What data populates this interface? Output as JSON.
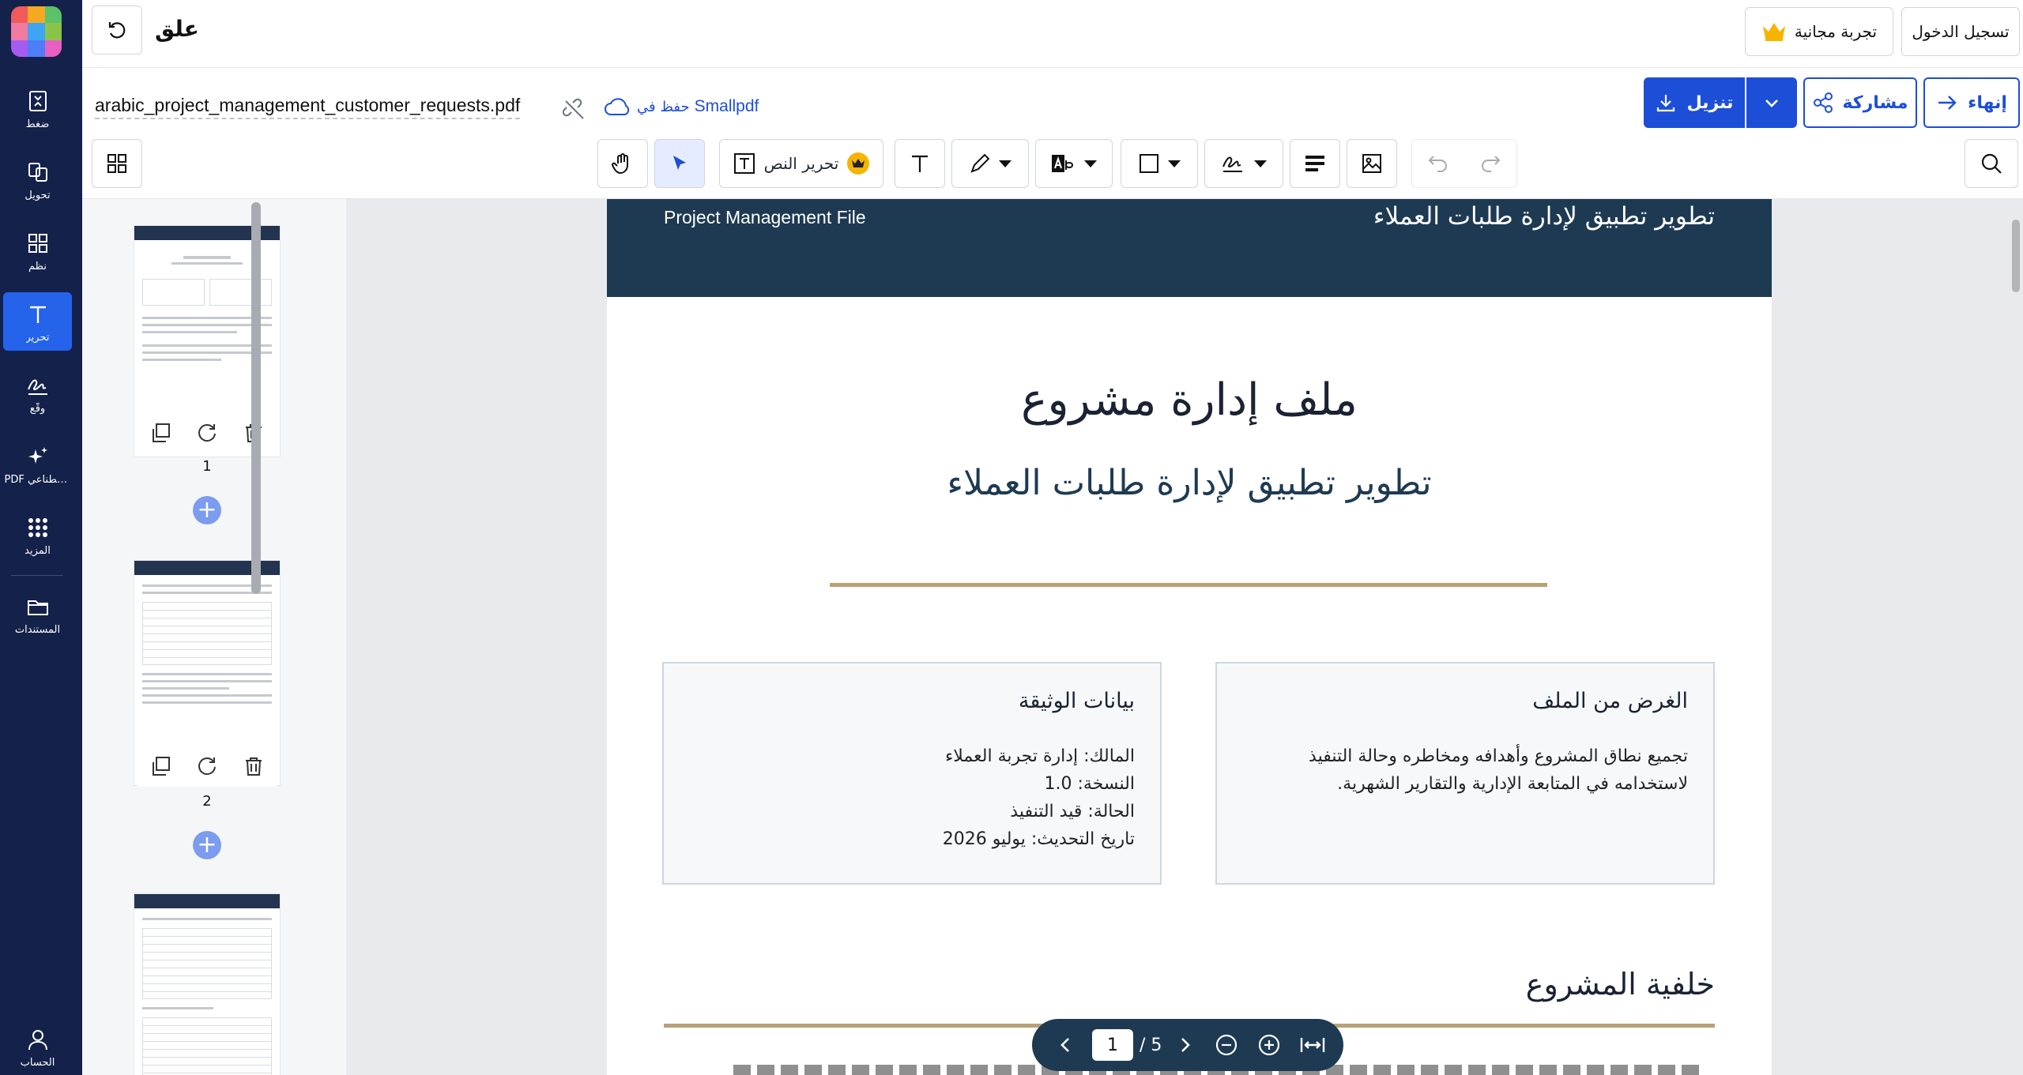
{
  "app": {
    "title": "علق",
    "login": "تسجيل الدخول",
    "free_trial": "تجربة مجانية",
    "finish": "إنهاء",
    "share": "مشاركة",
    "download": "تنزيل"
  },
  "sidebar": {
    "items": [
      {
        "label": "ضغط",
        "icon": "compress-icon"
      },
      {
        "label": "تحويل",
        "icon": "convert-icon"
      },
      {
        "label": "نظم",
        "icon": "organize-grid-icon"
      },
      {
        "label": "تحرير",
        "icon": "edit-text-icon"
      },
      {
        "label": "وقّع",
        "icon": "sign-icon"
      },
      {
        "label": "PDF ذكاء اصطناعي",
        "icon": "ai-sparkle-icon"
      },
      {
        "label": "المزيد",
        "icon": "more-apps-icon"
      },
      {
        "label": "المستندات",
        "icon": "folder-icon"
      },
      {
        "label": "الحساب",
        "icon": "account-icon"
      }
    ]
  },
  "file": {
    "name": "arabic_project_management_customer_requests.pdf",
    "save_in": "حفظ في",
    "save_target": "Smallpdf"
  },
  "toolbar": {
    "edit_text": "تحرير النص"
  },
  "thumbnails": {
    "pages": [
      "1",
      "2"
    ]
  },
  "document": {
    "header_left": "Project Management File",
    "header_right": "تطوير تطبيق لإدارة طلبات العملاء",
    "title": "ملف إدارة مشروع",
    "subtitle": "تطوير تطبيق لإدارة طلبات العملاء",
    "purpose_box": {
      "heading": "الغرض من الملف",
      "body": "تجميع نطاق المشروع وأهدافه ومخاطره وحالة التنفيذ لاستخدامه في المتابعة الإدارية والتقارير الشهرية."
    },
    "data_box": {
      "heading": "بيانات الوثيقة",
      "lines": [
        "المالك: إدارة تجربة العملاء",
        "النسخة: 1.0",
        "الحالة: قيد التنفيذ",
        "تاريخ التحديث: يوليو 2026"
      ]
    },
    "section_title": "خلفية المشروع"
  },
  "pager": {
    "current": "1",
    "total": "/ 5"
  },
  "colors": {
    "nav_bg": "#14214a",
    "primary": "#1d4ed8",
    "doc_band": "#1e3a52",
    "gold_rule": "#b8a175"
  }
}
